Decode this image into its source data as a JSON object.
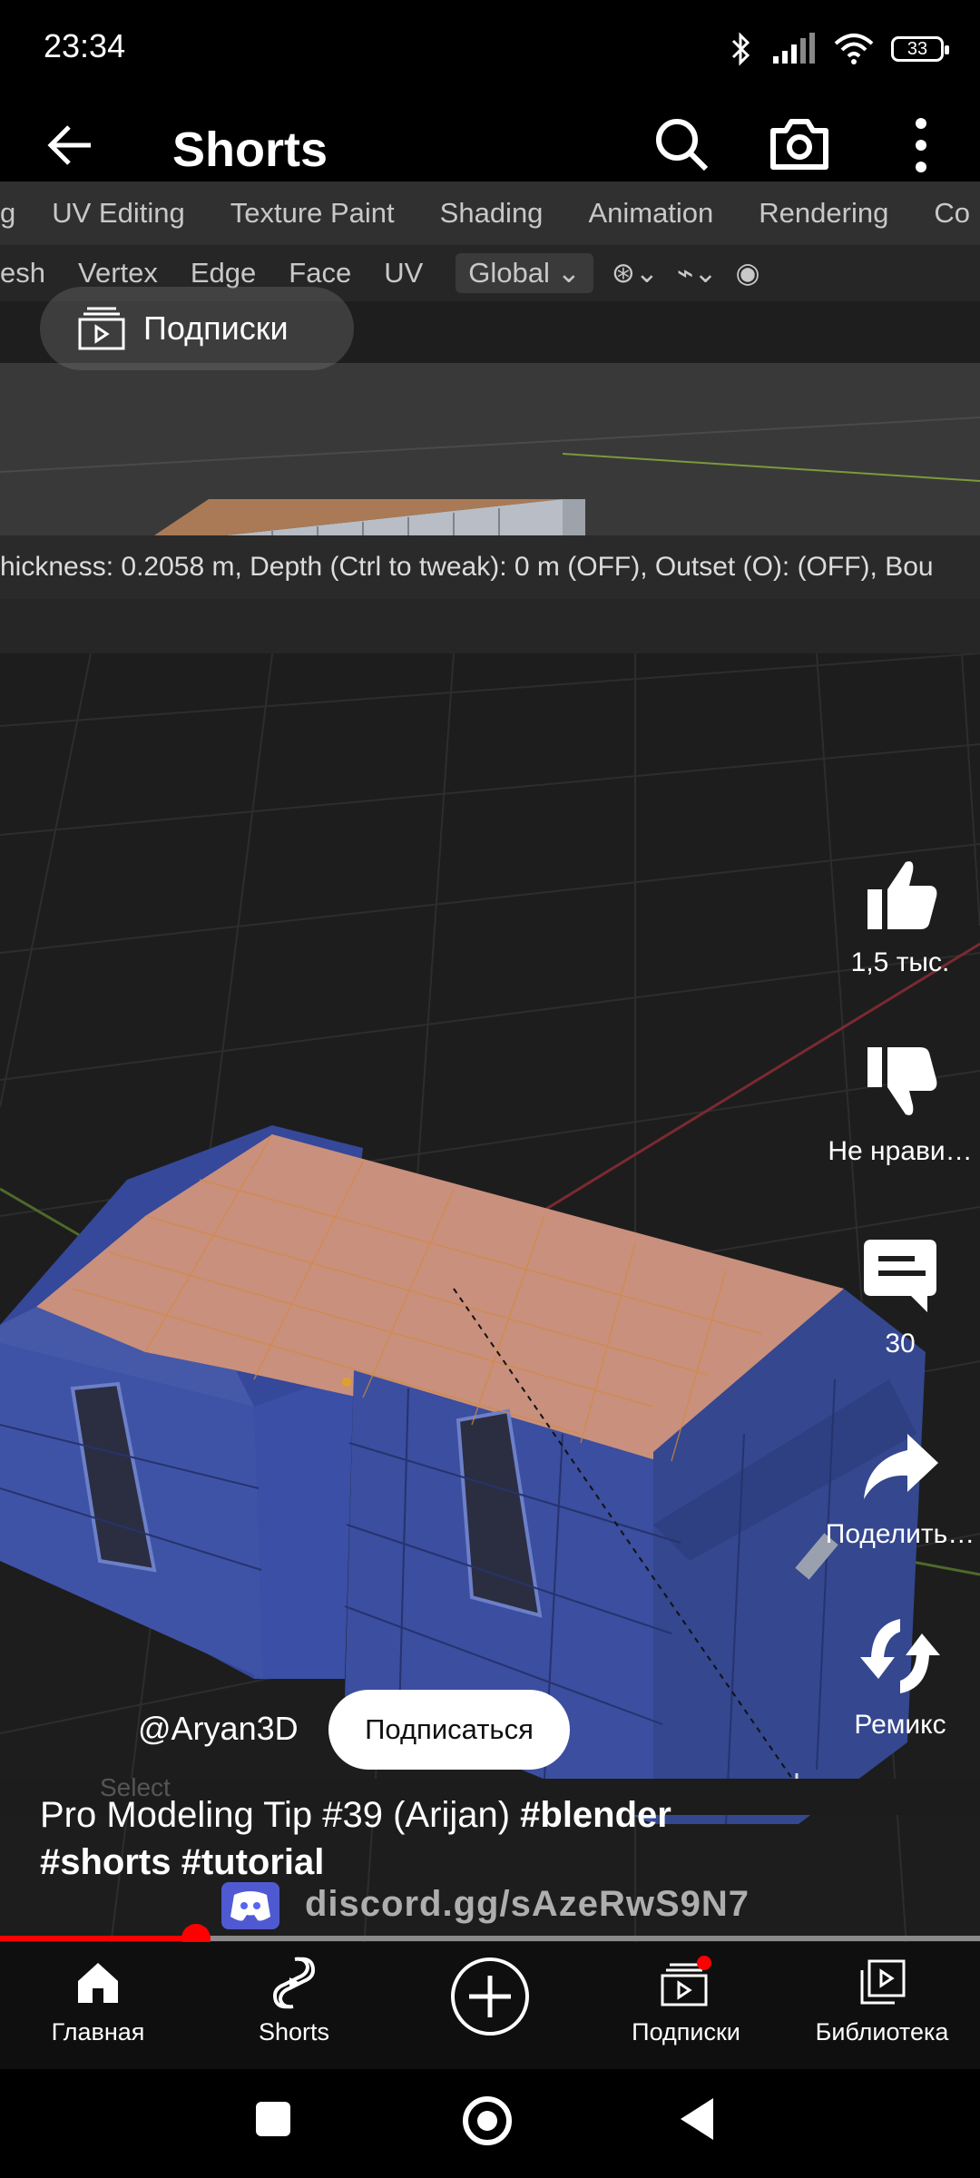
{
  "status_bar": {
    "time": "23:34",
    "battery": "33"
  },
  "app_bar": {
    "title": "Shorts"
  },
  "video": {
    "workspace_tabs": [
      "UV Editing",
      "Texture Paint",
      "Shading",
      "Animation",
      "Rendering",
      "Co"
    ],
    "leading_tab_fragment": "g",
    "header_items": [
      "esh",
      "Vertex",
      "Edge",
      "Face",
      "UV"
    ],
    "orientation": "Global",
    "operator_status": "hickness: 0.2058 m, Depth (Ctrl to tweak): 0 m (OFF), Outset (O): (OFF), Bou",
    "select_hint": "Select",
    "discord": "discord.gg/sAzeRwS9N7"
  },
  "subscriptions_pill": {
    "label": "Подписки"
  },
  "actions": {
    "like_count": "1,5 тыс.",
    "dislike_label": "Не нрави…",
    "comments_count": "30",
    "share_label": "Поделить…",
    "remix_label": "Ремикс"
  },
  "channel": {
    "handle": "@Aryan3D",
    "subscribe_label": "Подписаться"
  },
  "short": {
    "title_plain": "Pro Modeling Tip #39 (Arijan) ",
    "tag1": "#blender",
    "tags_line2": "#shorts #tutorial"
  },
  "progress": {
    "fraction": 0.2
  },
  "bottom_nav": [
    {
      "label": "Главная",
      "icon": "home-icon"
    },
    {
      "label": "Shorts",
      "icon": "shorts-icon"
    },
    {
      "label": "",
      "icon": "create-icon"
    },
    {
      "label": "Подписки",
      "icon": "subscriptions-icon"
    },
    {
      "label": "Библиотека",
      "icon": "library-icon"
    }
  ],
  "colors": {
    "accent": "#ff0000",
    "mesh_blue": "#3b4fa0",
    "selected_face": "#d9957a"
  }
}
